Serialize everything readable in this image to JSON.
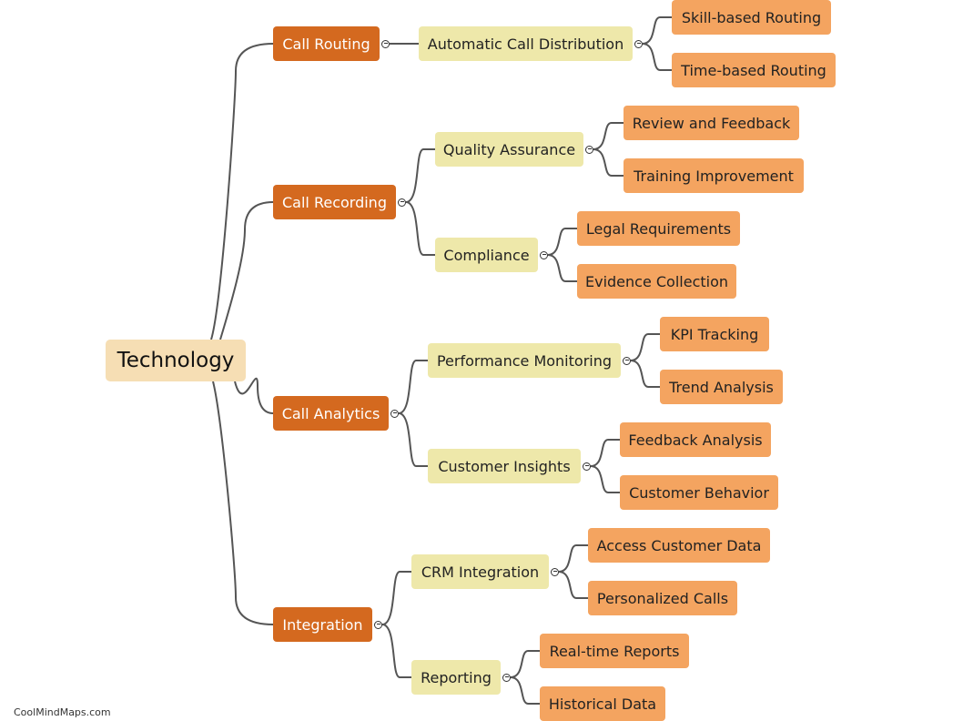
{
  "mindmap": {
    "root": {
      "id": "technology",
      "label": "Technology"
    },
    "branches": [
      {
        "id": "call-routing",
        "label": "Call Routing",
        "children": [
          {
            "id": "automatic-call-distribution",
            "label": "Automatic Call Distribution",
            "children": [
              {
                "id": "skill-based-routing",
                "label": "Skill-based Routing"
              },
              {
                "id": "time-based-routing",
                "label": "Time-based Routing"
              }
            ]
          }
        ]
      },
      {
        "id": "call-recording",
        "label": "Call Recording",
        "children": [
          {
            "id": "quality-assurance",
            "label": "Quality Assurance",
            "children": [
              {
                "id": "review-and-feedback",
                "label": "Review and Feedback"
              },
              {
                "id": "training-improvement",
                "label": "Training Improvement"
              }
            ]
          },
          {
            "id": "compliance",
            "label": "Compliance",
            "children": [
              {
                "id": "legal-requirements",
                "label": "Legal Requirements"
              },
              {
                "id": "evidence-collection",
                "label": "Evidence Collection"
              }
            ]
          }
        ]
      },
      {
        "id": "call-analytics",
        "label": "Call Analytics",
        "children": [
          {
            "id": "performance-monitoring",
            "label": "Performance Monitoring",
            "children": [
              {
                "id": "kpi-tracking",
                "label": "KPI Tracking"
              },
              {
                "id": "trend-analysis",
                "label": "Trend Analysis"
              }
            ]
          },
          {
            "id": "customer-insights",
            "label": "Customer Insights",
            "children": [
              {
                "id": "feedback-analysis",
                "label": "Feedback Analysis"
              },
              {
                "id": "customer-behavior",
                "label": "Customer Behavior"
              }
            ]
          }
        ]
      },
      {
        "id": "integration",
        "label": "Integration",
        "children": [
          {
            "id": "crm-integration",
            "label": "CRM Integration",
            "children": [
              {
                "id": "access-customer-data",
                "label": "Access Customer Data"
              },
              {
                "id": "personalized-calls",
                "label": "Personalized Calls"
              }
            ]
          },
          {
            "id": "reporting",
            "label": "Reporting",
            "children": [
              {
                "id": "real-time-reports",
                "label": "Real-time Reports"
              },
              {
                "id": "historical-data",
                "label": "Historical Data"
              }
            ]
          }
        ]
      }
    ]
  },
  "colors": {
    "root": "#f6deb4",
    "level1": "#d4691f",
    "level2": "#eee8aa",
    "level3": "#f4a460",
    "connector": "#555555"
  },
  "collapse_icon": "minus-circle-icon",
  "watermark": "CoolMindMaps.com"
}
